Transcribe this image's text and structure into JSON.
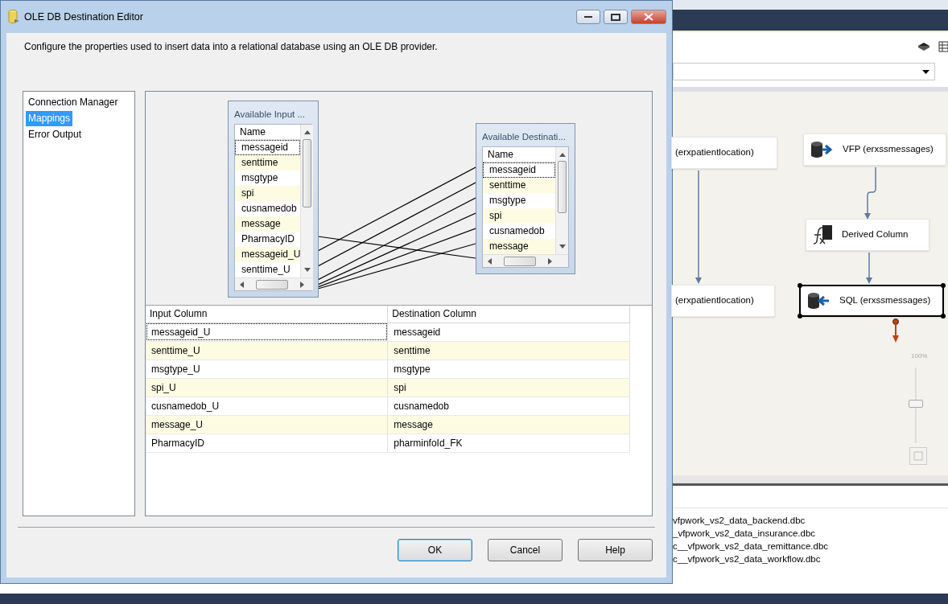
{
  "dialog": {
    "title": "OLE DB Destination Editor",
    "description": "Configure the properties used to insert data into a relational database using an OLE DB provider.",
    "nav": [
      {
        "label": "Connection Manager",
        "selected": false
      },
      {
        "label": "Mappings",
        "selected": true
      },
      {
        "label": "Error Output",
        "selected": false
      }
    ],
    "input_list": {
      "title": "Available Input ...",
      "header": "Name",
      "items": [
        "messageid",
        "senttime",
        "msgtype",
        "spi",
        "cusnamedob",
        "message",
        "PharmacyID",
        "messageid_U",
        "senttime_U"
      ]
    },
    "destination_list": {
      "title": "Available Destinati...",
      "header": "Name",
      "items": [
        "messageid",
        "senttime",
        "msgtype",
        "spi",
        "cusnamedob",
        "message"
      ]
    },
    "grid": {
      "columns": [
        "Input Column",
        "Destination Column"
      ],
      "rows": [
        {
          "input": "messageid_U",
          "destination": "messageid"
        },
        {
          "input": "senttime_U",
          "destination": "senttime"
        },
        {
          "input": "msgtype_U",
          "destination": "msgtype"
        },
        {
          "input": "spi_U",
          "destination": "spi"
        },
        {
          "input": "cusnamedob_U",
          "destination": "cusnamedob"
        },
        {
          "input": "message_U",
          "destination": "message"
        },
        {
          "input": "PharmacyID",
          "destination": "pharminfoId_FK"
        }
      ]
    },
    "buttons": [
      {
        "label": "OK",
        "default": true
      },
      {
        "label": "Cancel",
        "default": false
      },
      {
        "label": "Help",
        "default": false
      }
    ]
  },
  "designer": {
    "nodes": [
      {
        "label": "(erxpatientlocation)",
        "kind": "plain",
        "selected": false
      },
      {
        "label": "VFP (erxssmessages)",
        "kind": "source",
        "selected": false
      },
      {
        "label": "Derived Column",
        "kind": "transform",
        "selected": false
      },
      {
        "label": "(erxpatientlocation)",
        "kind": "plain",
        "selected": false
      },
      {
        "label": "SQL (erxssmessages)",
        "kind": "destination",
        "selected": true
      }
    ],
    "zoom": {
      "label": "100%",
      "level": 0.5
    }
  },
  "output": {
    "lines": [
      "vfpwork_vs2_data_backend.dbc",
      "_vfpwork_vs2_data_insurance.dbc",
      "c__vfpwork_vs2_data_remittance.dbc",
      "c__vfpwork_vs2_data_workflow.dbc"
    ]
  }
}
